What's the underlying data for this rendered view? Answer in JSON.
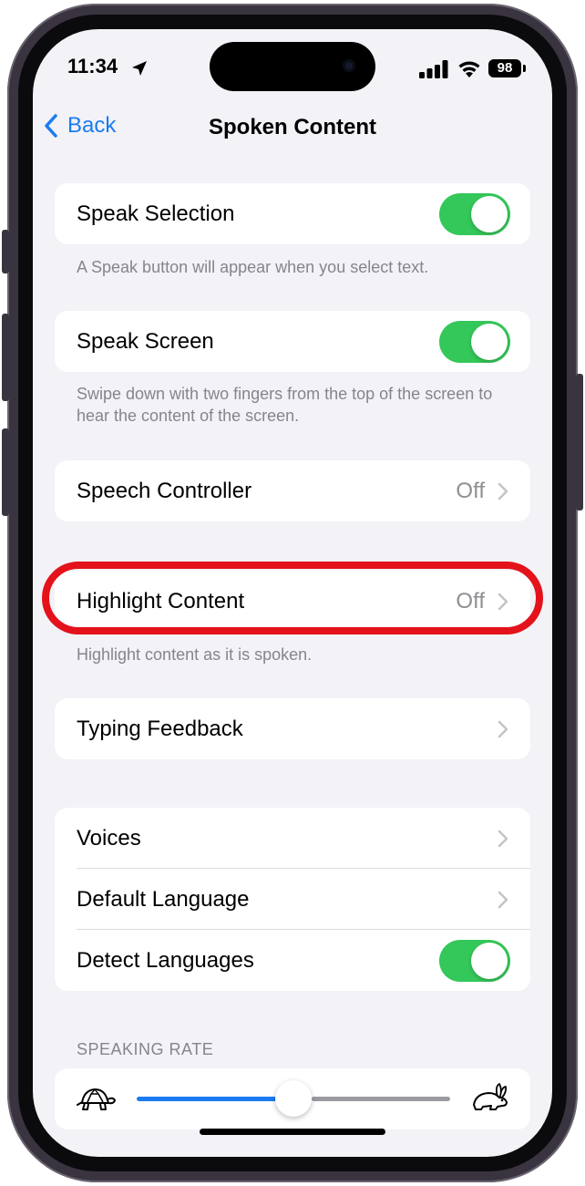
{
  "status": {
    "time": "11:34",
    "battery": "98"
  },
  "nav": {
    "back_label": "Back",
    "title": "Spoken Content"
  },
  "groups": {
    "speak_selection": {
      "label": "Speak Selection",
      "on": true,
      "footer": "A Speak button will appear when you select text."
    },
    "speak_screen": {
      "label": "Speak Screen",
      "on": true,
      "footer": "Swipe down with two fingers from the top of the screen to hear the content of the screen."
    },
    "speech_controller": {
      "label": "Speech Controller",
      "value": "Off"
    },
    "highlight_content": {
      "label": "Highlight Content",
      "value": "Off",
      "footer": "Highlight content as it is spoken."
    },
    "typing_feedback": {
      "label": "Typing Feedback"
    },
    "voices": {
      "label": "Voices"
    },
    "default_language": {
      "label": "Default Language"
    },
    "detect_languages": {
      "label": "Detect Languages",
      "on": true
    }
  },
  "speaking_rate": {
    "header": "SPEAKING RATE",
    "value_fraction": 0.5
  },
  "colors": {
    "accent": "#1a7cf0",
    "toggle_on": "#34c759",
    "highlight_ring": "#e3121b"
  },
  "icons": {
    "slow": "turtle-icon",
    "fast": "hare-icon"
  }
}
